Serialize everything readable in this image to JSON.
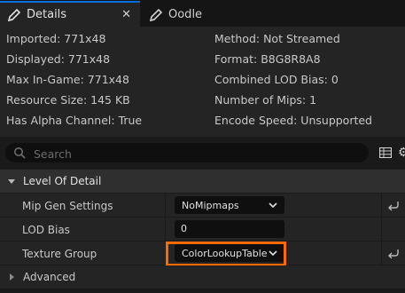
{
  "tabs": [
    {
      "label": "Details",
      "icon": "pencil-icon",
      "active": true,
      "close": "✕"
    },
    {
      "label": "Oodle",
      "icon": "pencil-icon",
      "active": false
    }
  ],
  "info": {
    "imported": "Imported: 771x48",
    "displayed": "Displayed: 771x48",
    "max_in_game": "Max In-Game: 771x48",
    "resource_size": "Resource Size: 145 KB",
    "has_alpha": "Has Alpha Channel: True",
    "method": "Method: Not Streamed",
    "format": "Format: B8G8R8A8",
    "combined_lod_bias": "Combined LOD Bias: 0",
    "num_mips": "Number of Mips: 1",
    "encode_speed": "Encode Speed: Unsupported"
  },
  "search": {
    "placeholder": "Search"
  },
  "sections": {
    "level_of_detail": "Level Of Detail",
    "advanced": "Advanced"
  },
  "properties": [
    {
      "label": "Mip Gen Settings",
      "value": "NoMipmaps",
      "type": "combo"
    },
    {
      "label": "LOD Bias",
      "value": "0",
      "type": "number"
    },
    {
      "label": "Texture Group",
      "value": "ColorLookupTable",
      "type": "combo"
    }
  ],
  "colors": {
    "accent": "#0070e0",
    "highlight": "#ff6a00",
    "panel": "#242424",
    "background": "#1a1a1a"
  }
}
